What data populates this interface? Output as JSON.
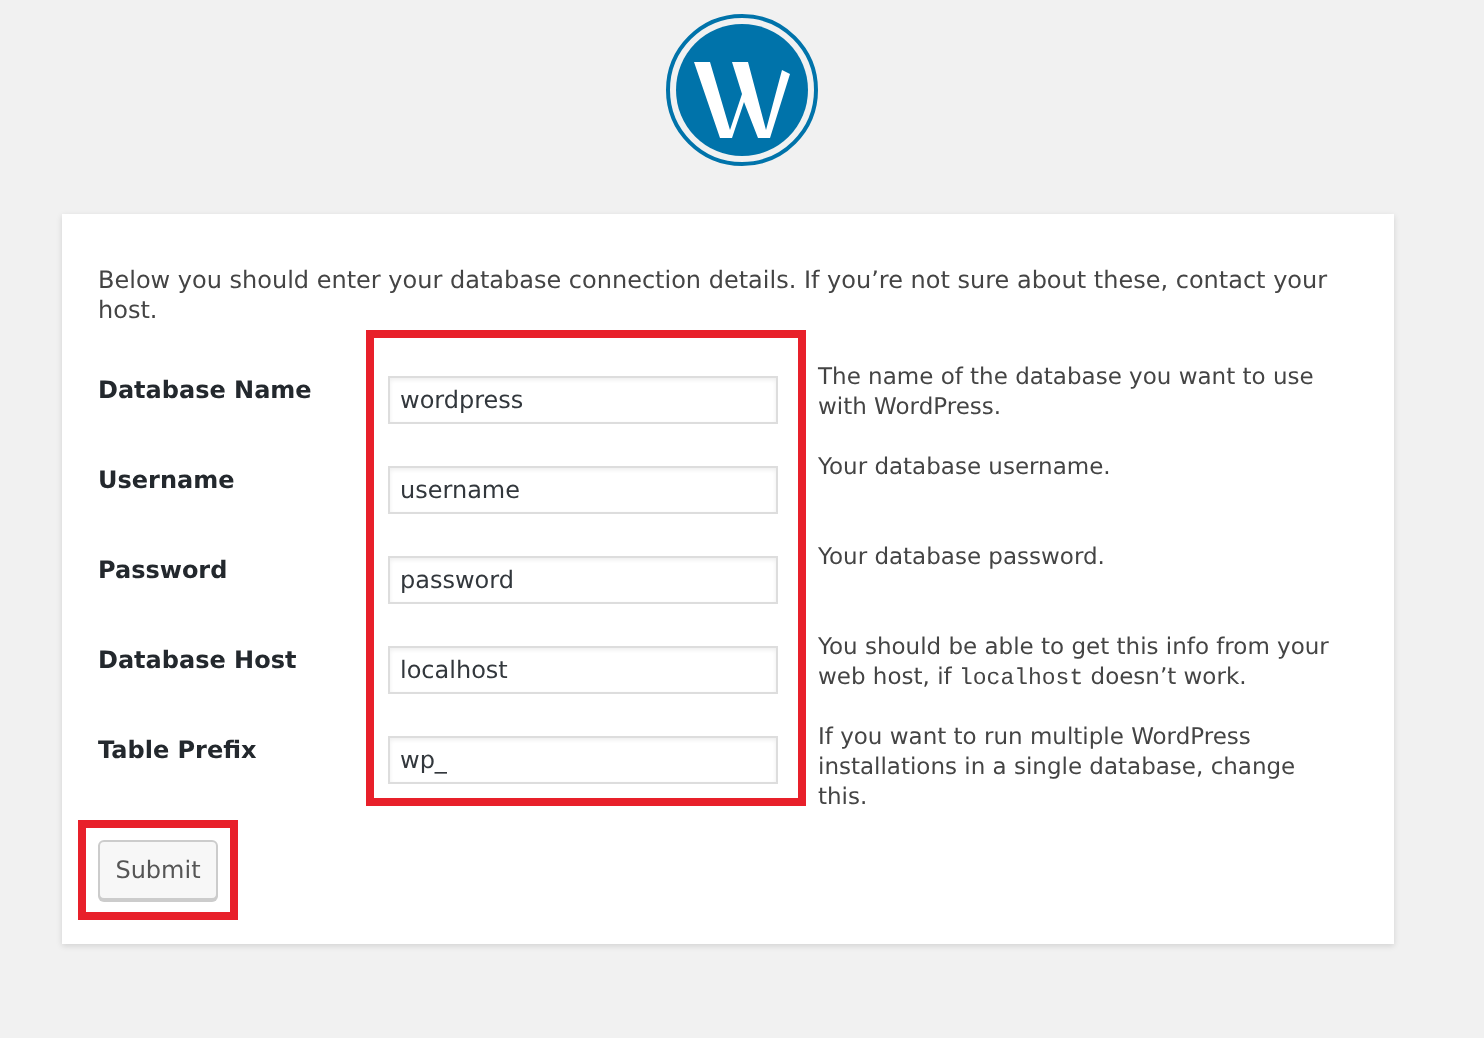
{
  "intro": "Below you should enter your database connection details. If you’re not sure about these, contact your host.",
  "fields": [
    {
      "label": "Database Name",
      "value": "wordpress",
      "help": [
        {
          "kind": "text",
          "text": "The name of the database you want to use with WordPress."
        }
      ]
    },
    {
      "label": "Username",
      "value": "username",
      "help": [
        {
          "kind": "text",
          "text": "Your database username."
        }
      ]
    },
    {
      "label": "Password",
      "value": "password",
      "help": [
        {
          "kind": "text",
          "text": "Your database password."
        }
      ]
    },
    {
      "label": "Database Host",
      "value": "localhost",
      "help": [
        {
          "kind": "text",
          "text": "You should be able to get this info from your web host, if "
        },
        {
          "kind": "code",
          "text": "localhost"
        },
        {
          "kind": "text",
          "text": " doesn’t work."
        }
      ]
    },
    {
      "label": "Table Prefix",
      "value": "wp_",
      "help": [
        {
          "kind": "text",
          "text": "If you want to run multiple WordPress installations in a single database, change this."
        }
      ]
    }
  ],
  "submit": "Submit"
}
